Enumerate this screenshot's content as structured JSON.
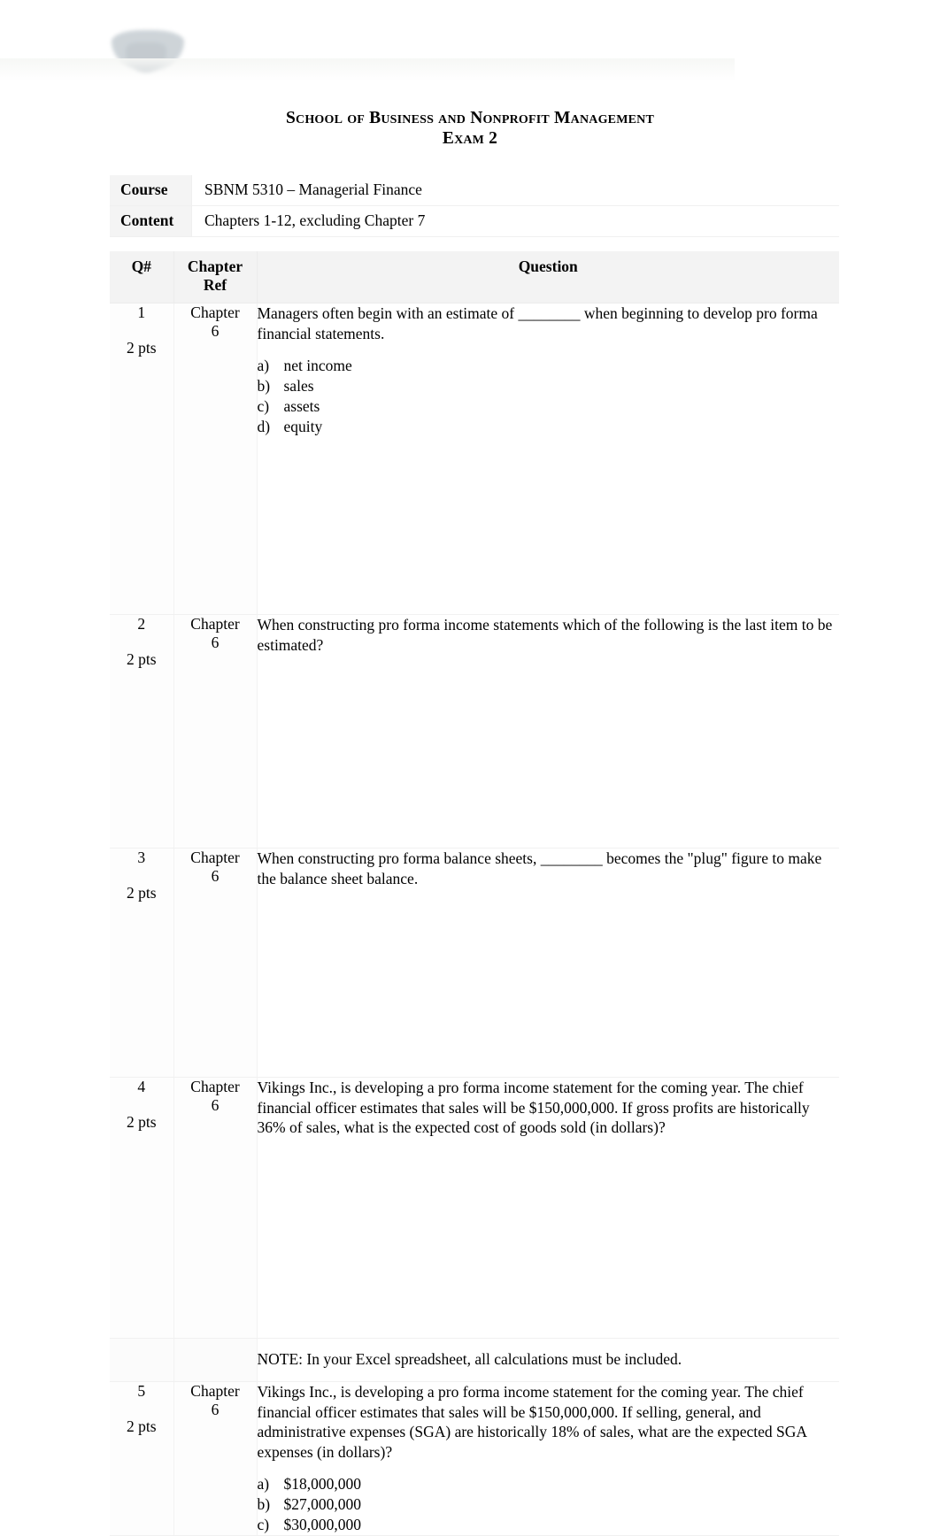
{
  "document": {
    "title": "School of Business and Nonprofit Management",
    "subtitle": "Exam 2"
  },
  "logo": {
    "name": "institution-logo"
  },
  "info": {
    "course_label": "Course",
    "course_value": "SBNM 5310 – Managerial Finance",
    "content_label": "Content",
    "content_value": "Chapters 1-12, excluding Chapter 7"
  },
  "table": {
    "headers": {
      "number": "Q#",
      "chapter_ref_line1": "Chapter",
      "chapter_ref_line2": "Ref",
      "question": "Question"
    },
    "rows": [
      {
        "number": "1",
        "points": "2 pts",
        "chapter_line1": "Chapter",
        "chapter_line2": "6",
        "question": "Managers often begin with an estimate of ________ when beginning to develop pro forma financial statements.",
        "options": [
          {
            "mark": "a)",
            "text": "net income"
          },
          {
            "mark": "b)",
            "text": "sales"
          },
          {
            "mark": "c)",
            "text": "assets"
          },
          {
            "mark": "d)",
            "text": "equity"
          }
        ]
      },
      {
        "number": "2",
        "points": "2 pts",
        "chapter_line1": "Chapter",
        "chapter_line2": "6",
        "question": "When constructing pro forma income statements which of the following is the last item to be estimated?",
        "options": []
      },
      {
        "number": "3",
        "points": "2 pts",
        "chapter_line1": "Chapter",
        "chapter_line2": "6",
        "question": "When constructing pro forma balance sheets, ________ becomes the \"plug\" figure to make the balance sheet balance.",
        "options": []
      },
      {
        "number": "4",
        "points": "2 pts",
        "chapter_line1": "Chapter",
        "chapter_line2": "6",
        "question": "Vikings Inc., is developing a pro forma income statement for the coming year. The chief financial officer estimates that sales will be $150,000,000. If gross profits are historically 36% of sales, what is the expected cost of goods sold (in dollars)?",
        "options": []
      },
      {
        "number": "",
        "points": "",
        "chapter_line1": "",
        "chapter_line2": "",
        "question": "NOTE: In your Excel spreadsheet, all calculations must be included.",
        "options": []
      },
      {
        "number": "5",
        "points": "2 pts",
        "chapter_line1": "Chapter",
        "chapter_line2": "6",
        "question": "Vikings Inc., is developing a pro forma income statement for the coming year. The chief financial officer estimates that sales will be $150,000,000. If selling, general, and administrative expenses (SGA) are historically 18% of sales, what are the expected SGA expenses (in dollars)?",
        "options": [
          {
            "mark": "a)",
            "text": "$18,000,000"
          },
          {
            "mark": "b)",
            "text": "$27,000,000"
          },
          {
            "mark": "c)",
            "text": "$30,000,000"
          }
        ]
      }
    ]
  }
}
